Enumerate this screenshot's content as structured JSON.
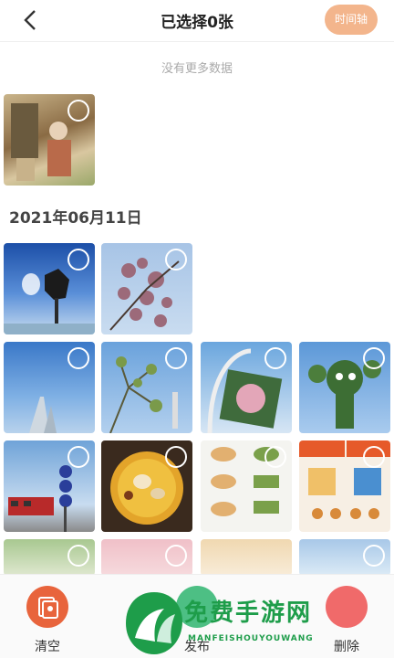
{
  "header": {
    "title": "已选择0张",
    "timeline_label": "时间轴"
  },
  "no_more_text": "没有更多数据",
  "date_group": {
    "label": "2021年06月11日"
  },
  "bottom_bar": {
    "clear_label": "清空",
    "publish_label": "发布",
    "delete_label": "删除"
  },
  "watermark": {
    "text": "免费手游网",
    "sub": "MANFEISHOUYOUWANG"
  },
  "colors": {
    "accent": "#f3b58c",
    "clear_icon": "#e8643c",
    "publish_icon": "#4dbf84",
    "delete_icon": "#f06a6a"
  }
}
